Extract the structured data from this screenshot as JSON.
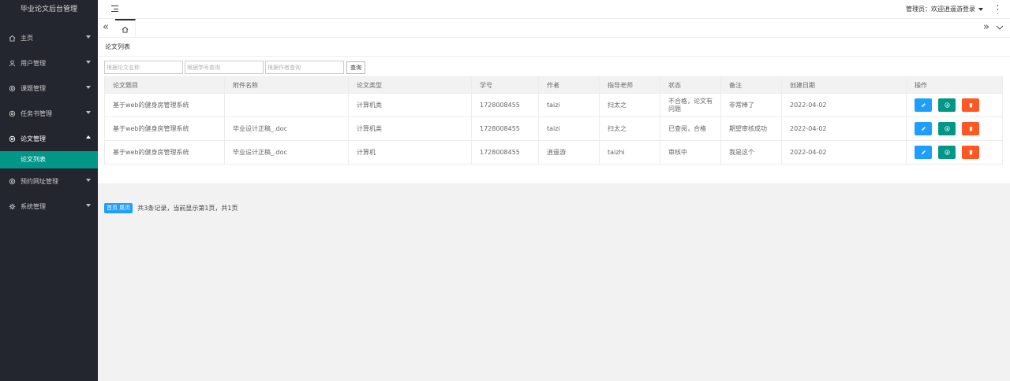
{
  "app_title": "毕业论文后台管理",
  "sidebar": {
    "items": [
      {
        "label": "主页",
        "icon": "home-icon"
      },
      {
        "label": "用户管理",
        "icon": "user-icon"
      },
      {
        "label": "课题管理",
        "icon": "gear-icon"
      },
      {
        "label": "任务书管理",
        "icon": "gear-icon"
      },
      {
        "label": "论文管理",
        "icon": "gear-icon",
        "open": true
      },
      {
        "label": "预约网址管理",
        "icon": "gear-icon"
      },
      {
        "label": "系统管理",
        "icon": "settings-icon"
      }
    ],
    "active_sub": "论文列表"
  },
  "header": {
    "admin_text": "管理员：欢迎逍遥游登录"
  },
  "tabs": {
    "prev_symbol": "«",
    "next_symbol": "»"
  },
  "page": {
    "title": "论文列表",
    "search": {
      "title_placeholder": "根据论文名称",
      "student_placeholder": "根据学号查询",
      "author_placeholder": "根据作者查询",
      "button_label": "查询"
    },
    "table": {
      "headers": [
        "论文题目",
        "附件名称",
        "论文类型",
        "学号",
        "作者",
        "指导老师",
        "状态",
        "备注",
        "创建日期",
        "操作"
      ],
      "rows": [
        {
          "title": "基于web的健身房管理系统",
          "attachment": "",
          "type": "计算机类",
          "student_no": "1728008455",
          "author": "taizi",
          "advisor": "扫太之",
          "status": "不合格，论文有问题",
          "status_color": "#ff0000",
          "remark": "非常棒了",
          "date": "2022-04-02"
        },
        {
          "title": "基于web的健身房管理系统",
          "attachment": "毕业设计正稿_.doc",
          "type": "计算机类",
          "student_no": "1728008455",
          "author": "taizi",
          "advisor": "扫太之",
          "status": "已查阅，合格",
          "status_color": "#009900",
          "remark": "期望审核成功",
          "date": "2022-04-02"
        },
        {
          "title": "基于web的健身房管理系统",
          "attachment": "毕业设计正稿_.doc",
          "type": "计算机",
          "student_no": "1728008455",
          "author": "逍遥游",
          "advisor": "taizhi",
          "status": "审核中",
          "status_color": "#0000e6",
          "remark": "我是这个",
          "date": "2022-04-02"
        }
      ]
    },
    "pager": {
      "button_label": "首页 尾页",
      "summary": "共3条记录，当前显示第1页，共1页"
    }
  }
}
